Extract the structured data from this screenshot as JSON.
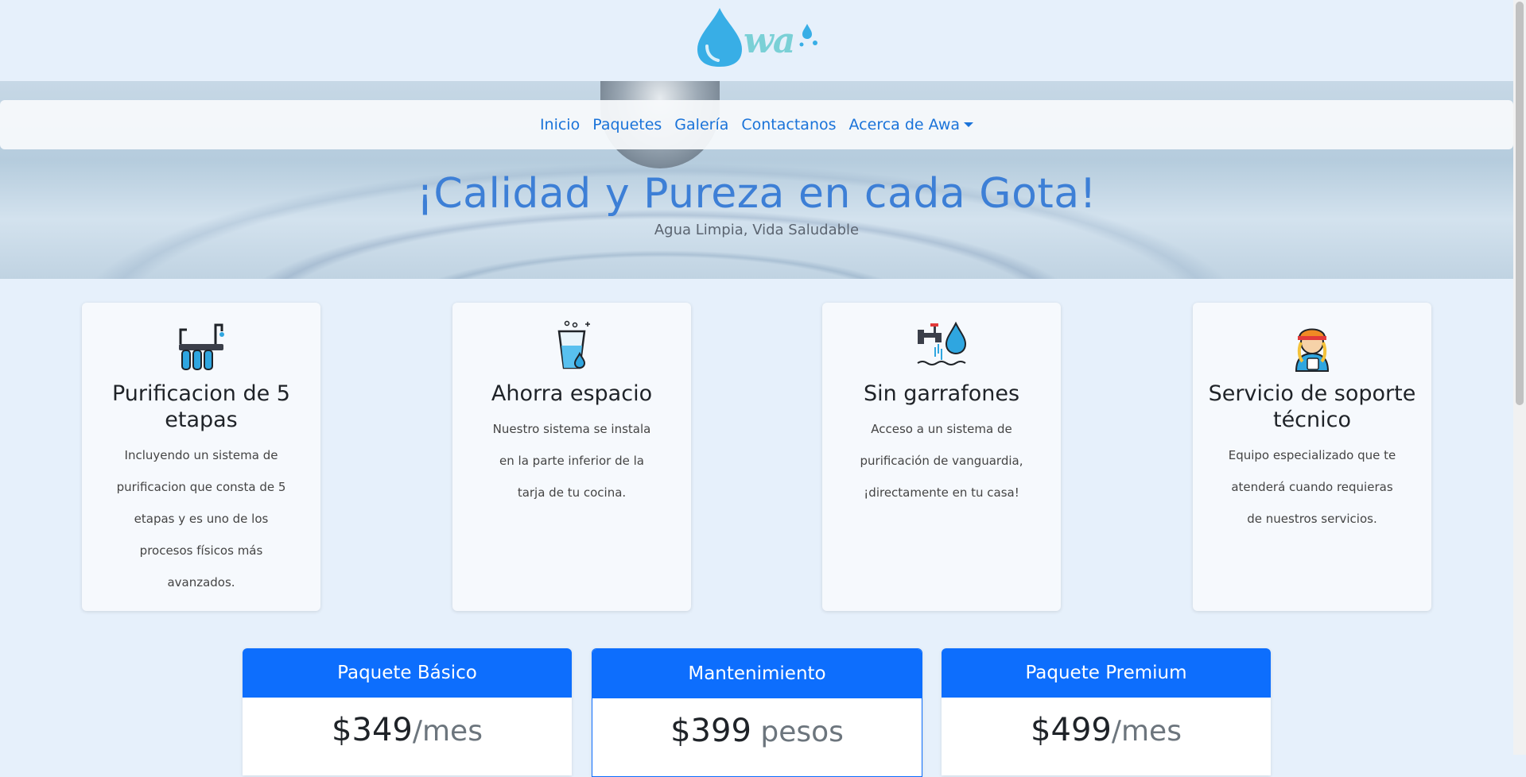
{
  "brand": {
    "logo_text": "wa"
  },
  "nav": {
    "items": [
      "Inicio",
      "Paquetes",
      "Galería",
      "Contactanos",
      "Acerca de Awa"
    ]
  },
  "hero": {
    "title": "¡Calidad y Pureza en cada Gota!",
    "subtitle": "Agua Limpia, Vida Saludable"
  },
  "features": [
    {
      "icon": "water-filter-icon",
      "title": "Purificacion de 5 etapas",
      "text": "Incluyendo un sistema de purificacion que consta de 5 etapas y es uno de los procesos físicos más avanzados."
    },
    {
      "icon": "water-glass-icon",
      "title": "Ahorra espacio",
      "text": "Nuestro sistema se instala en la parte inferior de la tarja de tu cocina."
    },
    {
      "icon": "water-tap-icon",
      "title": "Sin garrafones",
      "text": "Acceso a un sistema de purificación de vanguardia, ¡directamente en tu casa!"
    },
    {
      "icon": "technician-icon",
      "title": "Servicio de soporte técnico",
      "text": "Equipo especializado que te atenderá cuando requieras de nuestros servicios."
    }
  ],
  "pricing": [
    {
      "name": "Paquete Básico",
      "price": "$349",
      "unit": "/mes"
    },
    {
      "name": "Mantenimiento",
      "price": "$399",
      "unit": " pesos"
    },
    {
      "name": "Paquete Premium",
      "price": "$499",
      "unit": "/mes"
    }
  ],
  "colors": {
    "primary": "#0d6efd",
    "link": "#1a73d9",
    "background": "#e6f0fb",
    "hero_title": "#3d7fd6"
  }
}
